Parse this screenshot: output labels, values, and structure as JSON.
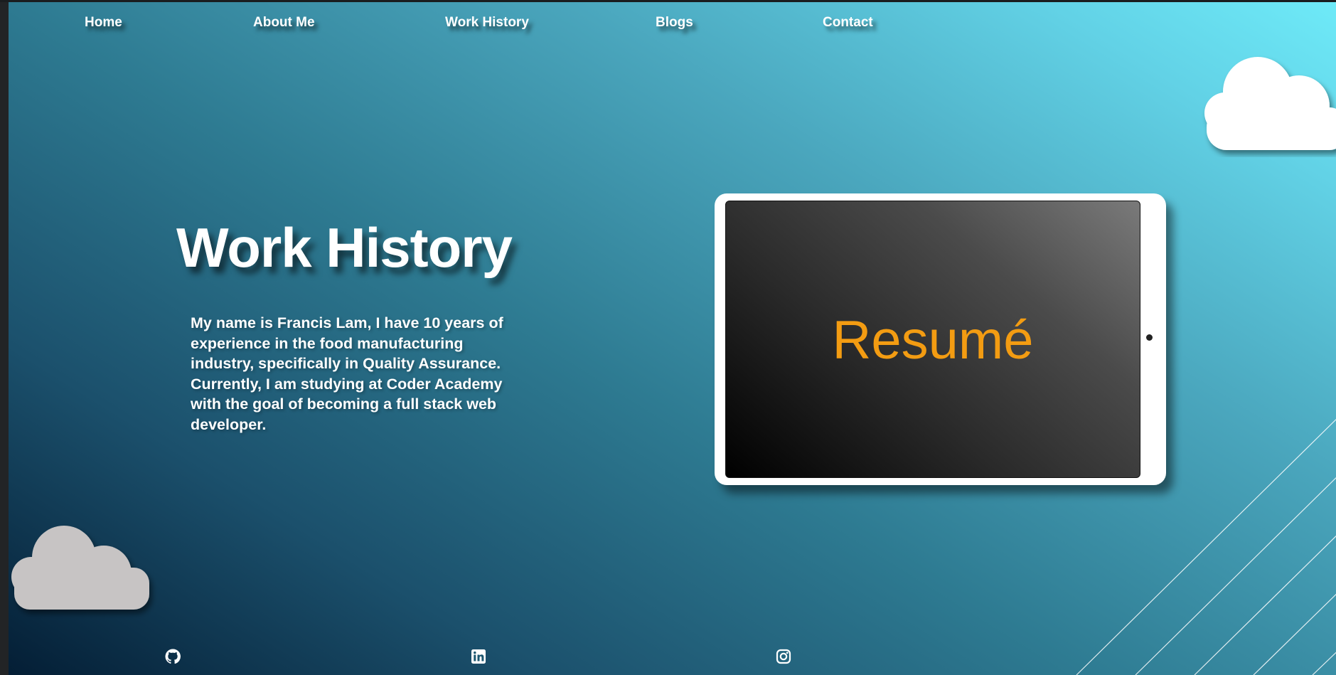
{
  "nav": {
    "items": [
      {
        "label": "Home"
      },
      {
        "label": "About Me"
      },
      {
        "label": "Work History"
      },
      {
        "label": "Blogs"
      },
      {
        "label": "Contact"
      }
    ]
  },
  "hero": {
    "title": "Work History",
    "bio": "My name is Francis Lam, I have 10 years of experience in the food manufacturing industry, specifically in Quality Assurance. Currently, I am studying at Coder Academy with the goal of becoming a full stack web developer."
  },
  "tablet": {
    "label": "Resumé"
  },
  "social": [
    {
      "icon": "github-icon"
    },
    {
      "icon": "linkedin-icon"
    },
    {
      "icon": "instagram-icon"
    }
  ],
  "colors": {
    "accent": "#f39c12",
    "text": "#ffffff",
    "gradient_dark": "#041e35",
    "gradient_light": "#6eeaf8",
    "cloud_white": "#ffffff",
    "cloud_grey": "#c7c4c4"
  }
}
